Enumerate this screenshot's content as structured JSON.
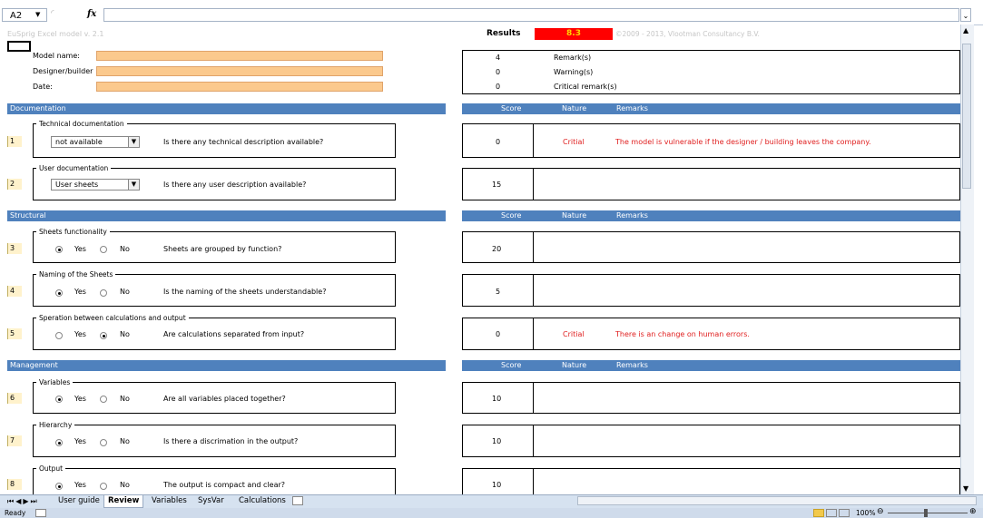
{
  "formula_bar": {
    "name_box": "A2",
    "fx_label": "fx",
    "formula_value": ""
  },
  "header": {
    "model_version": "EuSprig Excel model v. 2.1",
    "results_label": "Results",
    "results_value": "8.3",
    "copyright": "©2009 - 2013, Vlootman Consultancy B.V."
  },
  "model_info": {
    "fields": [
      {
        "label": "Model name:",
        "value": ""
      },
      {
        "label": "Designer/builder",
        "value": ""
      },
      {
        "label": "Date:",
        "value": ""
      }
    ]
  },
  "summary": [
    {
      "count": "4",
      "label": "Remark(s)"
    },
    {
      "count": "0",
      "label": "Warning(s)"
    },
    {
      "count": "0",
      "label": "Critical remark(s)"
    }
  ],
  "right_headers": {
    "score": "Score",
    "nature": "Nature",
    "remarks": "Remarks"
  },
  "sections": {
    "documentation": "Documentation",
    "structural": "Structural",
    "management": "Management"
  },
  "questions": [
    {
      "num": "1",
      "group": "Technical documentation",
      "control": "select",
      "selected": "not available",
      "question": "Is there any technical description available?",
      "score": "0",
      "nature": "Critial",
      "remark": "The model is vulnerable if the designer / building leaves the company."
    },
    {
      "num": "2",
      "group": "User documentation",
      "control": "select",
      "selected": "User sheets",
      "question": "Is there any user description available?",
      "score": "15",
      "nature": "",
      "remark": ""
    },
    {
      "num": "3",
      "group": "Sheets functionality",
      "control": "radio",
      "yes": true,
      "question": "Sheets are grouped by function?",
      "score": "20",
      "nature": "",
      "remark": ""
    },
    {
      "num": "4",
      "group": "Naming of the Sheets",
      "control": "radio",
      "yes": true,
      "question": "Is the naming of the sheets understandable?",
      "score": "5",
      "nature": "",
      "remark": ""
    },
    {
      "num": "5",
      "group": "Speration between calculations and output",
      "control": "radio",
      "yes": false,
      "question": "Are calculations separated from input?",
      "score": "0",
      "nature": "Critial",
      "remark": "There is an change on human errors."
    },
    {
      "num": "6",
      "group": "Variables",
      "control": "radio",
      "yes": true,
      "question": "Are all variables placed together?",
      "score": "10",
      "nature": "",
      "remark": ""
    },
    {
      "num": "7",
      "group": "Hierarchy",
      "control": "radio",
      "yes": true,
      "question": "Is there a discrimation in the output?",
      "score": "10",
      "nature": "",
      "remark": ""
    },
    {
      "num": "8",
      "group": "Output",
      "control": "radio",
      "yes": true,
      "question": "The output is compact and clear?",
      "score": "10",
      "nature": "",
      "remark": ""
    }
  ],
  "radio_labels": {
    "yes": "Yes",
    "no": "No"
  },
  "sheet_tabs": [
    {
      "label": "User guide",
      "active": false
    },
    {
      "label": "Review",
      "active": true
    },
    {
      "label": "Variables",
      "active": false
    },
    {
      "label": "SysVar",
      "active": false
    },
    {
      "label": "Calculations",
      "active": false
    }
  ],
  "status_bar": {
    "status": "Ready",
    "zoom": "100%"
  }
}
